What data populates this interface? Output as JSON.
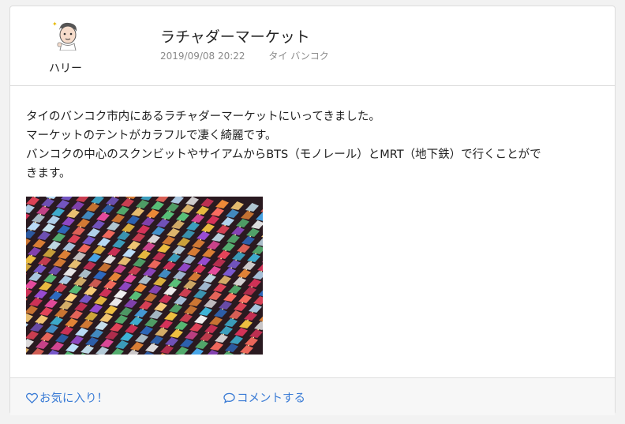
{
  "post": {
    "author": "ハリー",
    "title": "ラチャダーマーケット",
    "datetime": "2019/09/08 20:22",
    "location": "タイ バンコク",
    "body_lines": [
      "タイのバンコク市内にあるラチャダーマーケットにいってきました。",
      "マーケットのテントがカラフルで凄く綺麗です。",
      "バンコクの中心のスクンビットやサイアムからBTS（モノレール）とMRT（地下鉄）で行くことがで",
      "きます。"
    ]
  },
  "actions": {
    "favorite_label": "お気に入り！",
    "comment_label": "コメントする",
    "favorite_icon": "heart-outline-icon",
    "comment_icon": "speech-bubble-icon"
  },
  "colors": {
    "link": "#3a7bd5",
    "border": "#dddddd",
    "meta_text": "#8a8a8a"
  }
}
